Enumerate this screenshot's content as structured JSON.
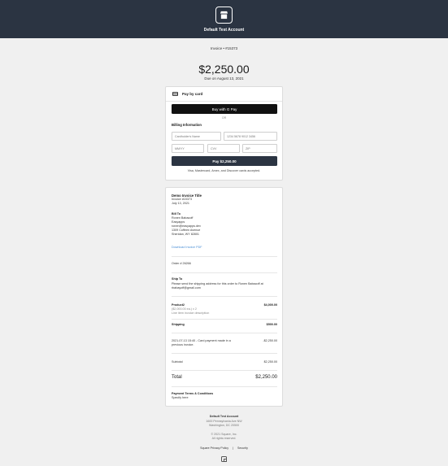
{
  "header": {
    "store_name": "Default Test Account"
  },
  "invoice": {
    "number": "Invoice • #15373",
    "amount": "$2,250.00",
    "due": "Due on August 13, 2021"
  },
  "payment": {
    "title": "Pay by card",
    "gpay_label": "Buy with G Pay",
    "or_label": "OR",
    "billing_label": "Billing Information",
    "fields": {
      "cardholder_placeholder": "Cardholder's Name",
      "card_placeholder": "1234 5678 9012 3456",
      "expiry_placeholder": "MM/YY",
      "cvv_placeholder": "CVV",
      "zip_placeholder": "ZIP"
    },
    "pay_button": "Pay $2,250.00",
    "accepted": "Visa, Mastercard, Amex, and Discover cards accepted."
  },
  "details": {
    "title": "Demo Invoice Title",
    "number": "Invoice #15373",
    "date": "July 13, 2021",
    "bill_to_label": "Bill To",
    "bill_to_lines": [
      "Ronen Babacoff",
      "Easyapps",
      "ronen@easyapps.dev",
      "1309 Coffeen Avenue",
      "Sheridan, WY 82801"
    ],
    "download_link": "Download Invoice PDF",
    "order": "Order # 26266",
    "ship_to_label": "Ship To",
    "ship_to_text_1": "Please send the shipping address for this order to Ronen Babacoff at",
    "ship_to_text_2": "rbabayoff@gmail.com",
    "item_name": "Product2",
    "item_price": "$4,000.00",
    "item_qty": "($2,000.00 ea.) x 2",
    "item_desc": "Line item invoice description",
    "shipping_label": "Shipping",
    "shipping_value": "$500.00",
    "payment_line_1": "2021-07-13 15:40 - Card payment made in a",
    "payment_line_2": "previous invoice.",
    "payment_value": "-$2,250.00",
    "subtotal_label": "Subtotal",
    "subtotal_value": "$2,250.00",
    "total_label": "Total",
    "total_value": "$2,250.00",
    "terms_label": "Payment Terms & Conditions",
    "terms_text": "Specify here"
  },
  "footer": {
    "name": "Default Test Account",
    "address_1": "1600 Pennsylvania Ave NW",
    "address_2": "Washington, DC 20500",
    "copyright": "© 2021 Square, Inc.",
    "rights": "All rights reserved.",
    "privacy_link": "Square Privacy Policy",
    "separator": "|",
    "security_link": "Security"
  }
}
